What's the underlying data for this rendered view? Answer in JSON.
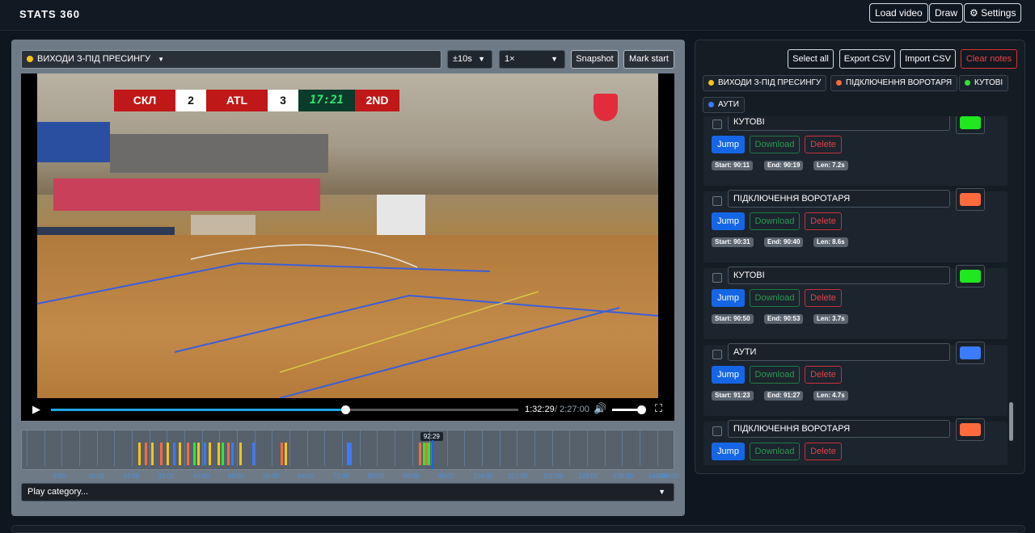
{
  "app": {
    "title": "STATS 360"
  },
  "toolbar": {
    "load": "Load video",
    "draw": "Draw",
    "settings": "Settings"
  },
  "player": {
    "category": "ВИХОДИ З-ПІД ПРЕСИНГУ",
    "category_color": "#f5c518",
    "skip": "±10s",
    "speed": "1×",
    "snapshot": "Snapshot",
    "mark_start": "Mark start",
    "current_time": "1:32:29",
    "total_time": "/ 2:27:00",
    "progress": 0.629,
    "volume": 0.9
  },
  "scoreboard": {
    "home": "СКЛ",
    "home_score": "2",
    "away": "ATL",
    "away_score": "3",
    "clock": "17:21",
    "period": "2ND"
  },
  "timeline": {
    "cursor_label": "92:29",
    "labels": [
      "8:00",
      "16:00",
      "24:00",
      "32:00",
      "40:00",
      "48:00",
      "56:00",
      "64:00",
      "72:00",
      "80:00",
      "88:00",
      "96:00",
      "104:00",
      "112:00",
      "120:00",
      "128:00",
      "136:00",
      "144:00",
      "146:00"
    ],
    "markers": [
      {
        "t": 25.5,
        "color": "#f5c518"
      },
      {
        "t": 27.0,
        "color": "#ff6a3d"
      },
      {
        "t": 28.5,
        "color": "#f5c518"
      },
      {
        "t": 30.5,
        "color": "#ff6a3d"
      },
      {
        "t": 32.0,
        "color": "#f5c518"
      },
      {
        "t": 33.5,
        "color": "#3b7bff"
      },
      {
        "t": 34.8,
        "color": "#f5c518"
      },
      {
        "t": 36.5,
        "color": "#ff6a3d"
      },
      {
        "t": 38.0,
        "color": "#2ee82e"
      },
      {
        "t": 39.0,
        "color": "#f5c518"
      },
      {
        "t": 40.5,
        "color": "#3b7bff"
      },
      {
        "t": 41.5,
        "color": "#f5c518"
      },
      {
        "t": 43.5,
        "color": "#f5c518"
      },
      {
        "t": 44.5,
        "color": "#2ee82e"
      },
      {
        "t": 45.8,
        "color": "#ff6a3d"
      },
      {
        "t": 46.8,
        "color": "#3b7bff"
      },
      {
        "t": 48.5,
        "color": "#f5c518"
      },
      {
        "t": 51.5,
        "color": "#3b7bff"
      },
      {
        "t": 58.0,
        "color": "#ff6a3d"
      },
      {
        "t": 59.0,
        "color": "#f5c518"
      },
      {
        "t": 73.2,
        "color": "#3b7bff"
      },
      {
        "t": 73.6,
        "color": "#3b7bff"
      },
      {
        "t": 89.5,
        "color": "#ff6a3d"
      },
      {
        "t": 90.5,
        "color": "#2ee82e"
      },
      {
        "t": 91.0,
        "color": "#ff6a3d"
      },
      {
        "t": 91.6,
        "color": "#2ee82e"
      },
      {
        "t": 92.3,
        "color": "#3b7bff"
      }
    ]
  },
  "play_category": "Play category...",
  "panel": {
    "select_all": "Select all",
    "export": "Export CSV",
    "import": "Import CSV",
    "clear": "Clear notes",
    "chips": [
      {
        "label": "ВИХОДИ З-ПІД ПРЕСИНГУ",
        "color": "#f5c518"
      },
      {
        "label": "ПІДКЛЮЧЕННЯ ВОРОТАРЯ",
        "color": "#ff6a3d"
      },
      {
        "label": "КУТОВІ",
        "color": "#2ee82e"
      },
      {
        "label": "АУТИ",
        "color": "#3b7bff"
      }
    ],
    "clips": [
      {
        "name": "КУТОВІ",
        "color": "#1fe81f",
        "start": "Start: 90:11",
        "end": "End: 90:19",
        "len": "Len: 7.2s"
      },
      {
        "name": "ПІДКЛЮЧЕННЯ ВОРОТАРЯ",
        "color": "#ff6a3d",
        "start": "Start: 90:31",
        "end": "End: 90:40",
        "len": "Len: 8.6s"
      },
      {
        "name": "КУТОВІ",
        "color": "#1fe81f",
        "start": "Start: 90:50",
        "end": "End: 90:53",
        "len": "Len: 3.7s"
      },
      {
        "name": "АУТИ",
        "color": "#3b7bff",
        "start": "Start: 91:23",
        "end": "End: 91:27",
        "len": "Len: 4.7s"
      },
      {
        "name": "ПІДКЛЮЧЕННЯ ВОРОТАРЯ",
        "color": "#ff6a3d",
        "start": "",
        "end": "",
        "len": ""
      }
    ],
    "jump": "Jump",
    "download": "Download",
    "delete": "Delete"
  }
}
